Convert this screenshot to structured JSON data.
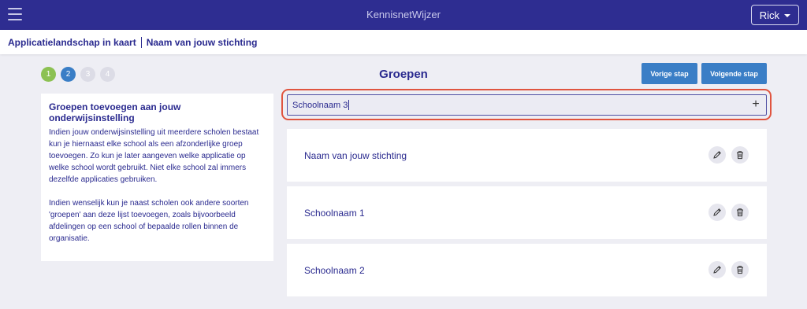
{
  "header": {
    "app_title": "KennisnetWijzer",
    "user_name": "Rick"
  },
  "breadcrumb": {
    "items": [
      "Applicatielandschap in kaart",
      "Naam van jouw stichting"
    ]
  },
  "steps": [
    {
      "label": "1",
      "state": "done"
    },
    {
      "label": "2",
      "state": "current"
    },
    {
      "label": "3",
      "state": "todo"
    },
    {
      "label": "4",
      "state": "todo"
    }
  ],
  "main": {
    "title": "Groepen",
    "prev_label": "Vorige stap",
    "next_label": "Volgende stap"
  },
  "info": {
    "title": "Groepen toevoegen aan jouw onderwijsinstelling",
    "paragraph1": "Indien jouw onderwijsinstelling uit meerdere scholen bestaat kun je hiernaast elke school als een afzonderlijke groep toevoegen. Zo kun je later aangeven welke applicatie op welke school wordt gebruikt. Niet elke school zal immers dezelfde applicaties gebruiken.",
    "paragraph2": "Indien wenselijk kun je naast scholen ook andere soorten 'groepen' aan deze lijst toevoegen, zoals bijvoorbeeld afdelingen op een school of bepaalde rollen binnen de organisatie."
  },
  "new_group": {
    "value": "Schoolnaam 3",
    "add_icon": "plus-icon"
  },
  "groups": [
    {
      "name": "Naam van jouw stichting"
    },
    {
      "name": "Schoolnaam 1"
    },
    {
      "name": "Schoolnaam 2"
    }
  ],
  "colors": {
    "topbar": "#2e2d91",
    "accent": "#3a7ec6",
    "step_done": "#8cc152",
    "highlight": "#e0543f",
    "text": "#2a2a8f"
  }
}
